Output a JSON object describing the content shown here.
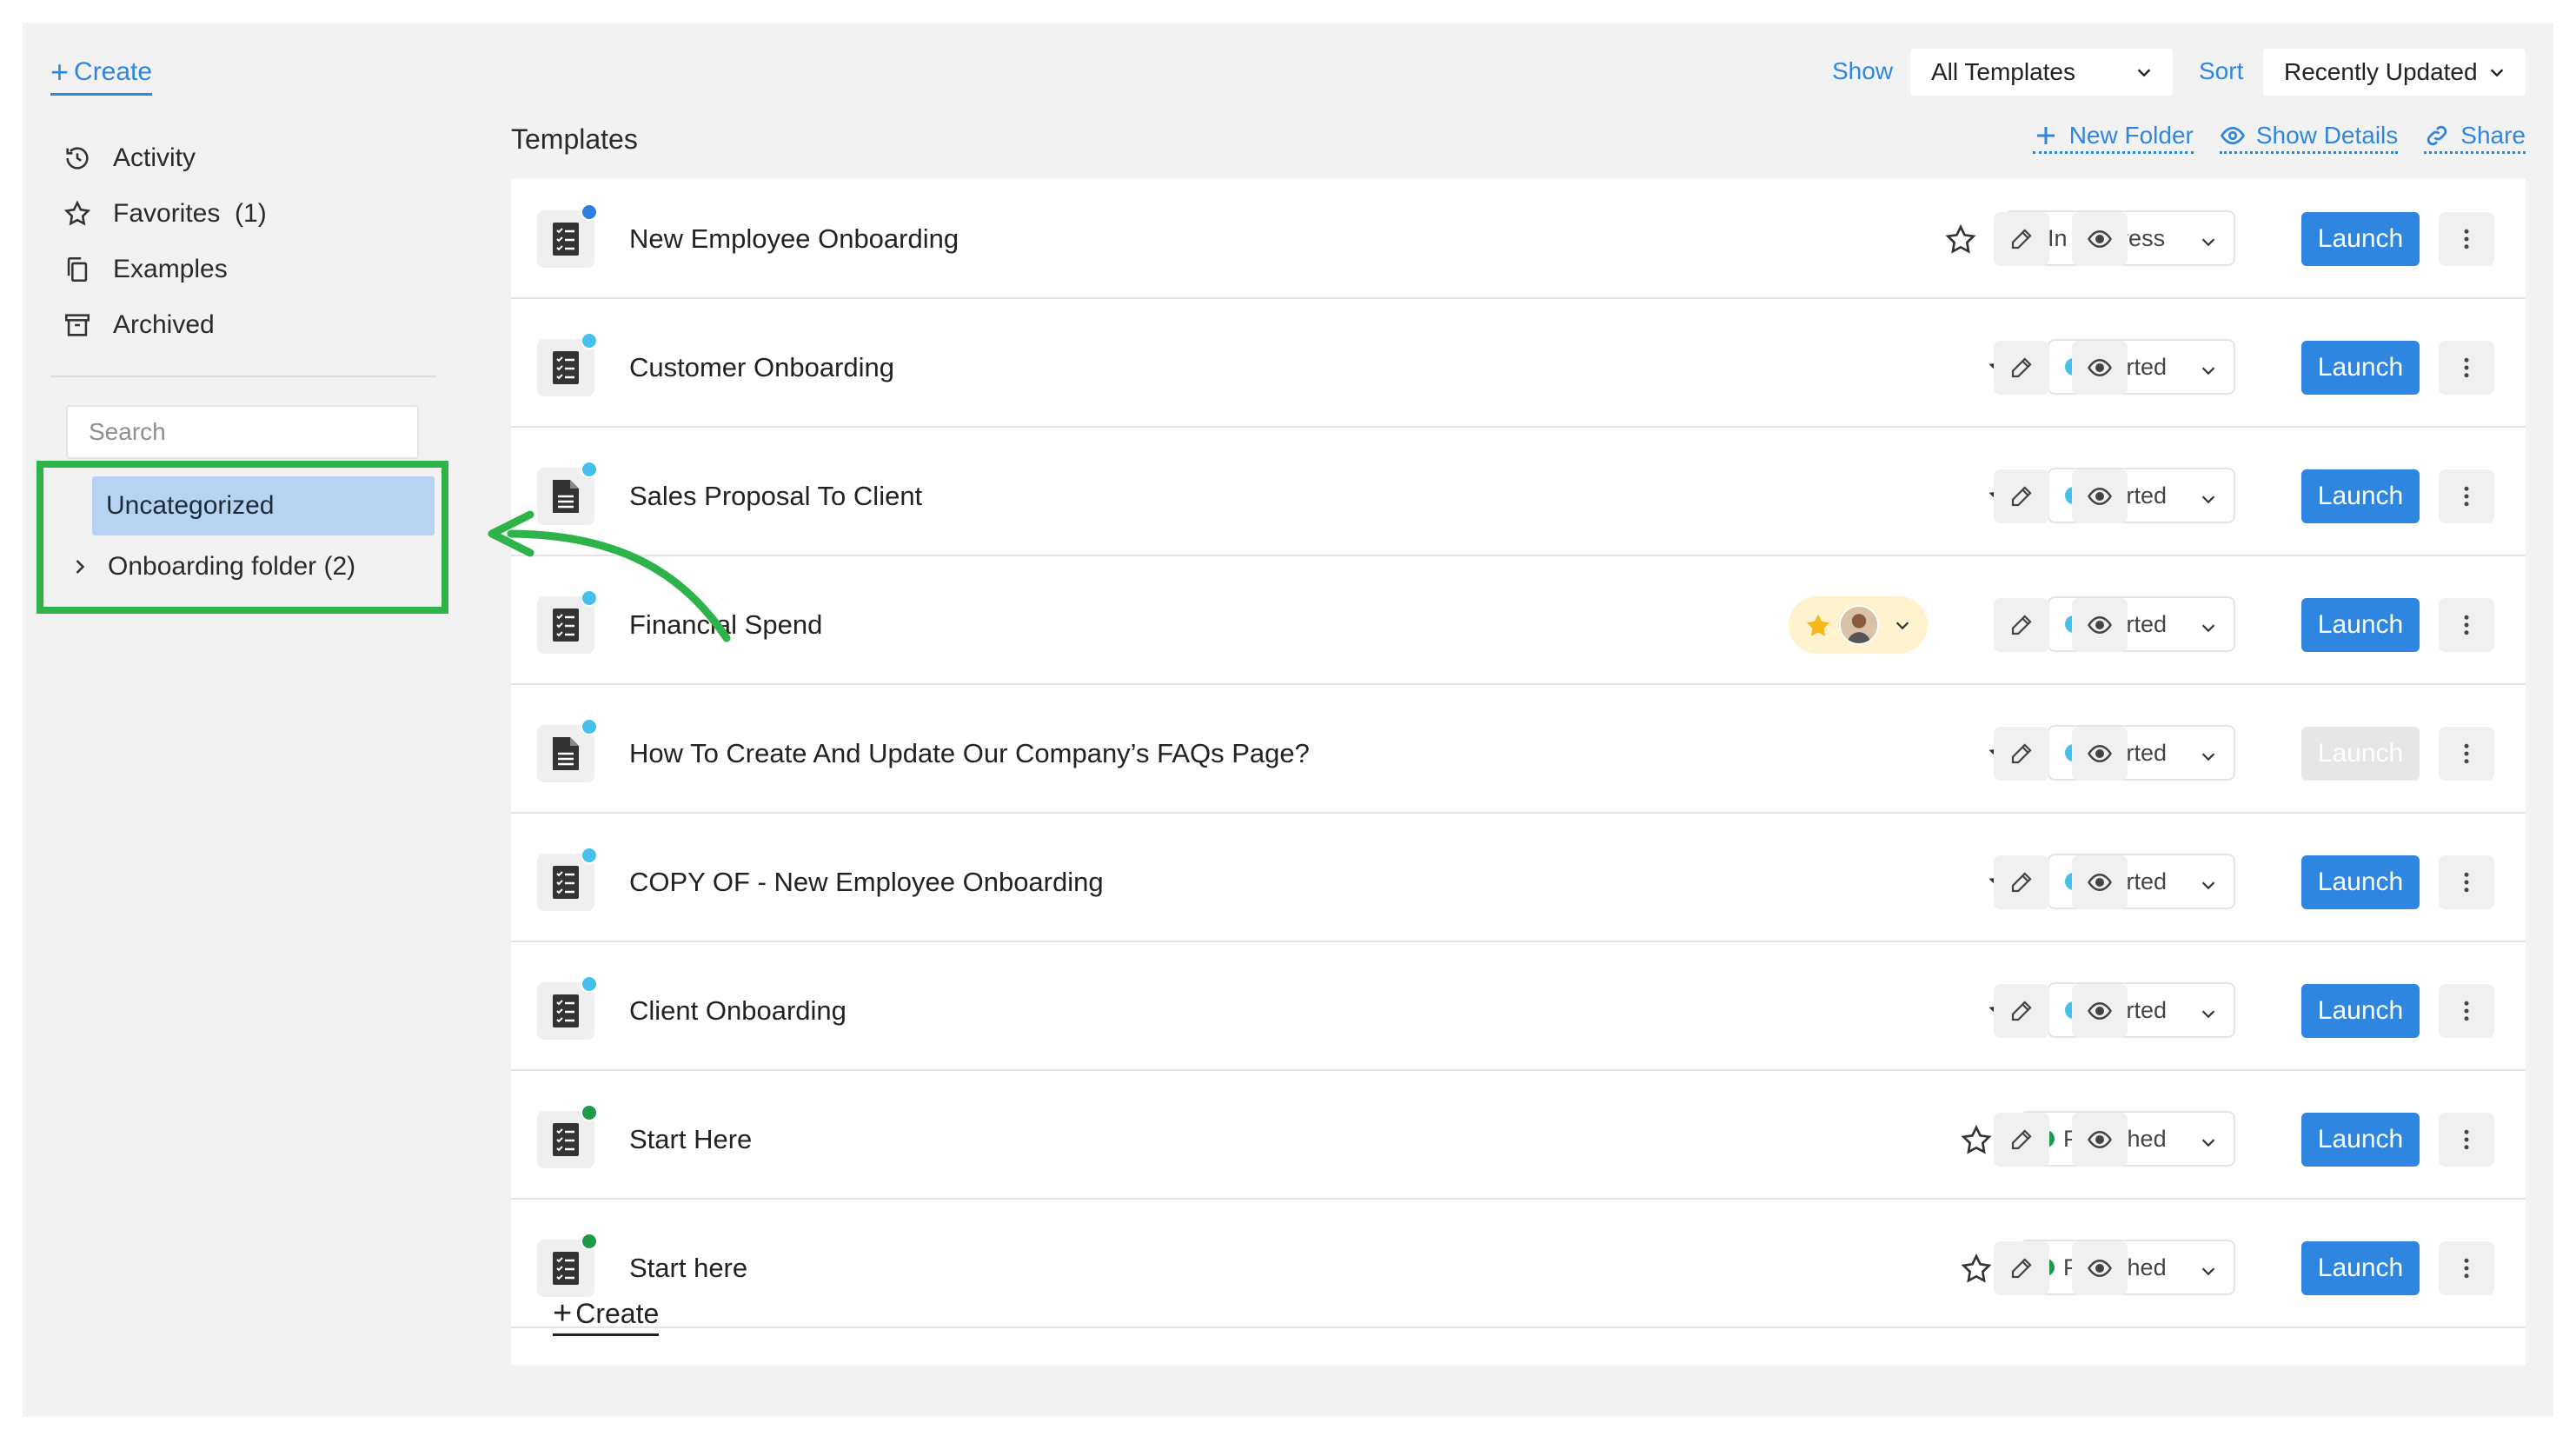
{
  "sidebar": {
    "create_label": "Create",
    "nav": [
      {
        "label": "Activity",
        "icon": "history-icon"
      },
      {
        "label": "Favorites  (1)",
        "icon": "star-outline-icon"
      },
      {
        "label": "Examples",
        "icon": "copy-icon"
      },
      {
        "label": "Archived",
        "icon": "archive-icon"
      }
    ],
    "search_placeholder": "Search",
    "folders": {
      "selected": "Uncategorized",
      "onboarding": "Onboarding folder (2)"
    }
  },
  "header": {
    "show_label": "Show",
    "show_value": "All Templates",
    "sort_label": "Sort",
    "sort_value": "Recently Updated",
    "title": "Templates",
    "actions": {
      "new_folder": "New Folder",
      "show_details": "Show Details",
      "share": "Share"
    }
  },
  "templates": [
    {
      "title": "New Employee Onboarding",
      "status": "In progress",
      "status_color": "#2f7fe0",
      "dot_color": "#2f7fe0",
      "icon": "checklist-icon",
      "launch": "Launch",
      "launch_enabled": true
    },
    {
      "title": "Customer Onboarding",
      "status": "Started",
      "status_color": "#46c0ea",
      "dot_color": "#46c0ea",
      "icon": "checklist-icon",
      "launch": "Launch",
      "launch_enabled": true
    },
    {
      "title": "Sales Proposal To Client",
      "status": "Started",
      "status_color": "#46c0ea",
      "dot_color": "#46c0ea",
      "icon": "document-icon",
      "launch": "Launch",
      "launch_enabled": true
    },
    {
      "title": "Financial Spend",
      "status": "Started",
      "status_color": "#46c0ea",
      "dot_color": "#46c0ea",
      "icon": "checklist-icon",
      "launch": "Launch",
      "launch_enabled": true,
      "starred": true
    },
    {
      "title": "How To Create And Update Our Company’s FAQs Page?",
      "status": "Started",
      "status_color": "#46c0ea",
      "dot_color": "#46c0ea",
      "icon": "document-icon",
      "launch": "Launch",
      "launch_enabled": false
    },
    {
      "title": "COPY OF - New Employee Onboarding",
      "status": "Started",
      "status_color": "#46c0ea",
      "dot_color": "#46c0ea",
      "icon": "checklist-icon",
      "launch": "Launch",
      "launch_enabled": true
    },
    {
      "title": "Client Onboarding",
      "status": "Started",
      "status_color": "#46c0ea",
      "dot_color": "#46c0ea",
      "icon": "checklist-icon",
      "launch": "Launch",
      "launch_enabled": true
    },
    {
      "title": "Start Here",
      "status": "Published",
      "status_color": "#1f9a4a",
      "dot_color": "#1f9a4a",
      "icon": "checklist-icon",
      "launch": "Launch",
      "launch_enabled": true
    },
    {
      "title": "Start here",
      "status": "Published",
      "status_color": "#1f9a4a",
      "dot_color": "#1f9a4a",
      "icon": "checklist-icon",
      "launch": "Launch",
      "launch_enabled": true
    }
  ],
  "create_bottom_label": "Create",
  "colors": {
    "accent": "#2f86e0",
    "highlight_box": "#2db34a",
    "selected_folder": "#b6d3f1"
  }
}
